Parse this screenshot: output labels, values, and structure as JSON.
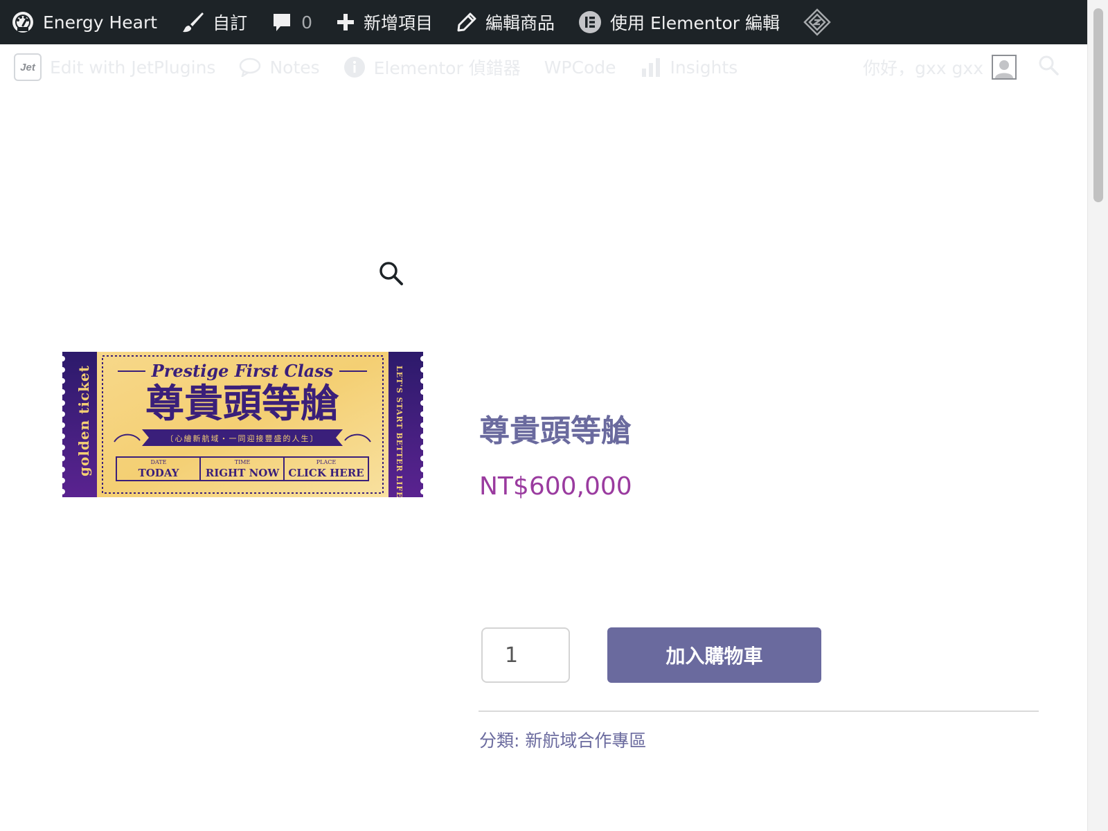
{
  "adminbar": {
    "site_name": "Energy Heart",
    "customize": "自訂",
    "comments_count": "0",
    "new_item": "新增項目",
    "edit_product": "編輯商品",
    "elementor_edit": "使用 Elementor 編輯"
  },
  "subbar": {
    "jet_logo": "Jet",
    "jetplugins": "Edit with JetPlugins",
    "notes": "Notes",
    "elementor_debugger": "Elementor 偵錯器",
    "wpcode": "WPCode",
    "insights": "Insights",
    "greeting": "你好，gxx gxx"
  },
  "product": {
    "title": "尊貴頭等艙",
    "price": "NT$600,000",
    "quantity": "1",
    "add_to_cart": "加入購物車",
    "category_label": "分類:",
    "category_value": "新航域合作專區",
    "ticket": {
      "script_title": "Prestige First Class",
      "main_title": "尊貴頭等艙",
      "subtitle": "〔心繪新航域・一同迎接豐盛的人生〕",
      "left_vertical": "golden ticket",
      "right_vertical": "LET'S START BETTER LIFE",
      "date_label": "DATE",
      "date_value": "TODAY",
      "time_label": "TIME",
      "time_value": "RIGHT NOW",
      "place_label": "PLACE",
      "place_value": "CLICK HERE"
    }
  },
  "colors": {
    "adminbar_bg": "#1d2327",
    "accent": "#6a6a9e",
    "price": "#9a3b9f",
    "ticket_purple": "#3a1f7a",
    "ticket_gold": "#f4cf73"
  }
}
